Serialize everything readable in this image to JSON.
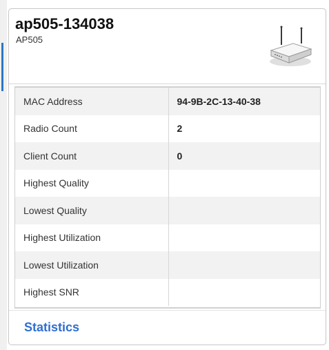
{
  "device": {
    "name": "ap505-134038",
    "model": "AP505",
    "icon": "wireless-router-icon"
  },
  "details": [
    {
      "label": "MAC Address",
      "value": "94-9B-2C-13-40-38"
    },
    {
      "label": "Radio Count",
      "value": "2"
    },
    {
      "label": "Client Count",
      "value": "0"
    },
    {
      "label": "Highest Quality",
      "value": ""
    },
    {
      "label": "Lowest Quality",
      "value": ""
    },
    {
      "label": "Highest Utilization",
      "value": ""
    },
    {
      "label": "Lowest Utilization",
      "value": ""
    },
    {
      "label": "Highest SNR",
      "value": ""
    }
  ],
  "footer": {
    "link_label": "Statistics"
  },
  "colors": {
    "link": "#2f6fd0",
    "row_alt": "#f2f2f2",
    "border": "#c9c9c9"
  }
}
